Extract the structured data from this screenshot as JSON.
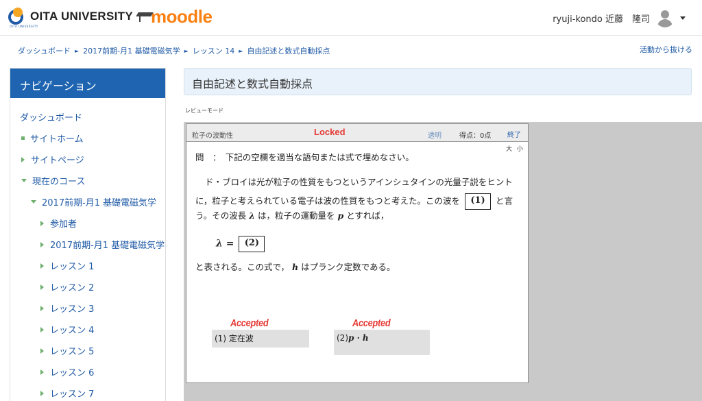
{
  "header": {
    "logo_text": "OITA UNIVERSITY",
    "logo_sub": "OITA UNIVERSITY",
    "moodle_text": "moodle",
    "user_name": "ryuji-kondo 近藤　隆司"
  },
  "breadcrumb": {
    "items": [
      "ダッシュボード",
      "2017前期-月1 基礎電磁気学",
      "レッスン 14",
      "自由記述と数式自動採点"
    ],
    "exit": "活動から抜ける"
  },
  "nav": {
    "title": "ナビゲーション",
    "items": [
      {
        "label": "ダッシュボード"
      },
      {
        "label": "サイトホーム"
      },
      {
        "label": "サイトページ"
      },
      {
        "label": "現在のコース"
      },
      {
        "label": "2017前期-月1 基礎電磁気学"
      },
      {
        "label": "参加者"
      },
      {
        "label": "2017前期-月1 基礎電磁気学"
      },
      {
        "label": "レッスン 1"
      },
      {
        "label": "レッスン 2"
      },
      {
        "label": "レッスン 3"
      },
      {
        "label": "レッスン 4"
      },
      {
        "label": "レッスン 5"
      },
      {
        "label": "レッスン 6"
      },
      {
        "label": "レッスン 7"
      }
    ]
  },
  "main": {
    "heading": "自由記述と数式自動採点",
    "review_mode": "レビューモード"
  },
  "question": {
    "topic": "粒子の波動性",
    "locked": "Locked",
    "transparent": "透明",
    "score": "得点：0点",
    "finish": "終了",
    "size_large": "大",
    "size_small": "小",
    "prompt": "問　：　下記の空欄を適当な語句または式で埋めなさい。",
    "line1": "ド・ブロイは光が粒子の性質をもつというアインシュタインの光量子説をヒント",
    "line2_pre": "に，粒子と考えられている電子は波の性質をもつと考えた。この波を",
    "blank1": "(1)",
    "line2_post": "と言",
    "line3_a": "う。その波長",
    "lambda": "λ",
    "line3_b": "は，粒子の運動量を",
    "p": "p",
    "line3_c": "とすれば，",
    "eq_lhs": "λ =",
    "blank2": "(2)",
    "line4_a": "と表される。この式で，",
    "h": "h",
    "line4_b": "はプランク定数である。"
  },
  "answers": [
    {
      "status": "Accepted",
      "label": "(1)",
      "value": "定在波"
    },
    {
      "status": "Accepted",
      "label": "(2)",
      "value": "p · h"
    }
  ],
  "colors": {
    "nav_header": "#1e64b0",
    "link": "#1f5aa6",
    "accepted": "#e53935",
    "moodle": "#f98012",
    "heading_bg": "#e9f2fa"
  }
}
